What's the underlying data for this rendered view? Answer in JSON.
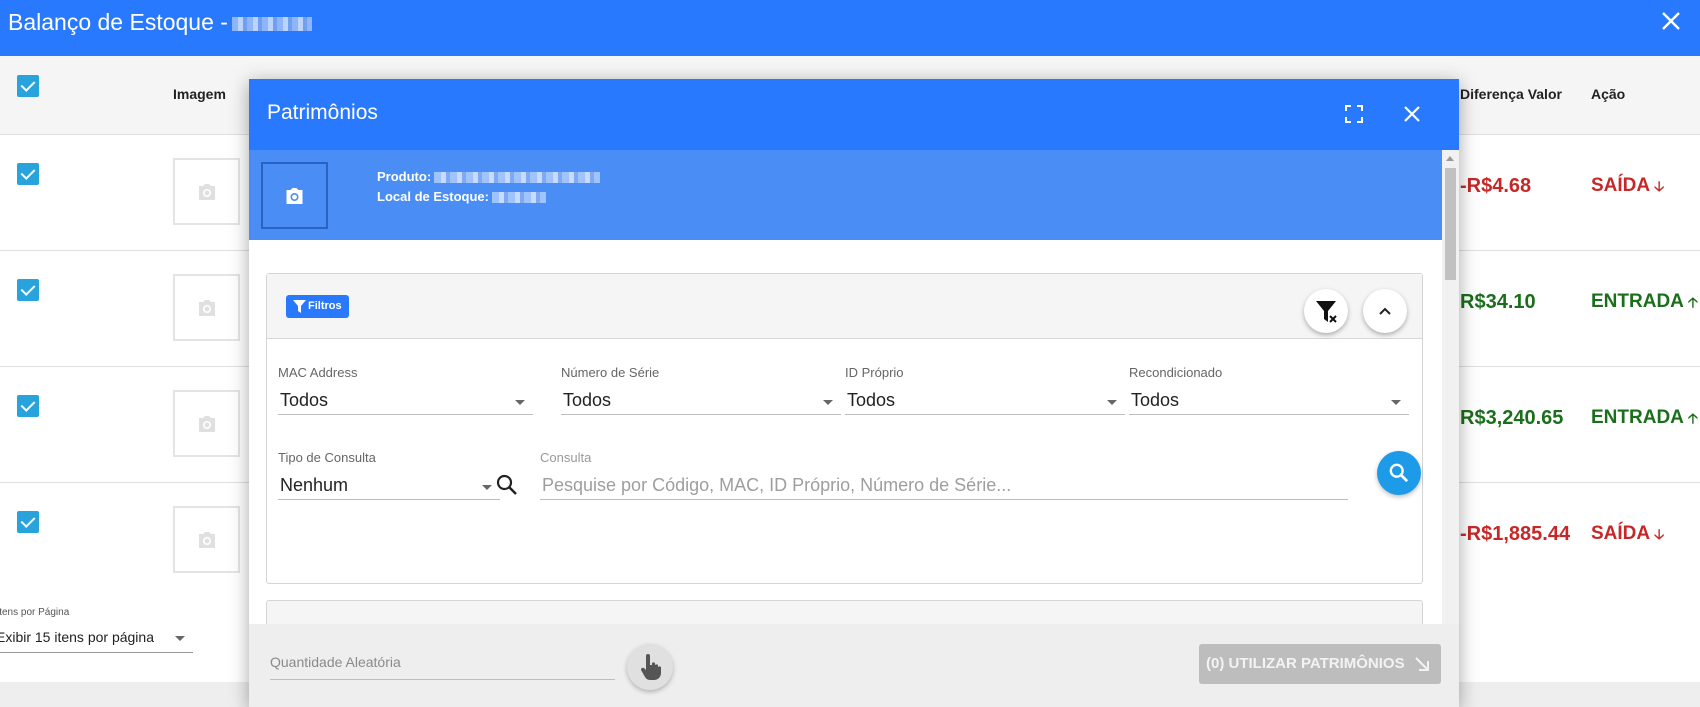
{
  "topbar": {
    "title": "Balanço de Estoque -"
  },
  "table": {
    "headers": {
      "image": "Imagem",
      "value_diff": "Diferença Valor",
      "action": "Ação"
    },
    "rows": [
      {
        "value_diff": "-R$4.68",
        "action": "SAÍDA",
        "direction": "down",
        "status_color": "#c62828"
      },
      {
        "value_diff": "R$34.10",
        "action": "ENTRADA",
        "direction": "up",
        "status_color": "#1b6e1b"
      },
      {
        "value_diff": "R$3,240.65",
        "action": "ENTRADA",
        "direction": "up",
        "status_color": "#1b6e1b"
      },
      {
        "value_diff": "-R$1,885.44",
        "action": "SAÍDA",
        "direction": "down",
        "status_color": "#c62828"
      }
    ],
    "per_page": {
      "label": "itens por Página",
      "value": "Exibir 15 itens por página"
    }
  },
  "modal": {
    "title": "Patrimônios",
    "product": {
      "product_label": "Produto:",
      "location_label": "Local de Estoque:"
    },
    "filters": {
      "badge": "Filtros",
      "mac": {
        "label": "MAC Address",
        "value": "Todos"
      },
      "serial": {
        "label": "Número de Série",
        "value": "Todos"
      },
      "own_id": {
        "label": "ID Próprio",
        "value": "Todos"
      },
      "refurb": {
        "label": "Recondicionado",
        "value": "Todos"
      },
      "query_type": {
        "label": "Tipo de Consulta",
        "value": "Nenhum"
      },
      "query": {
        "label": "Consulta",
        "placeholder": "Pesquise por Código, MAC, ID Próprio, Número de Série..."
      }
    },
    "footer": {
      "random_qty_placeholder": "Quantidade Aleatória",
      "use_button": "(0) UTILIZAR PATRIMÔNIOS"
    }
  },
  "colors": {
    "primary": "#2979ff",
    "checkbox": "#29a3dc",
    "negative": "#c62828",
    "positive": "#1b6e1b",
    "fab": "#1e9be8"
  }
}
